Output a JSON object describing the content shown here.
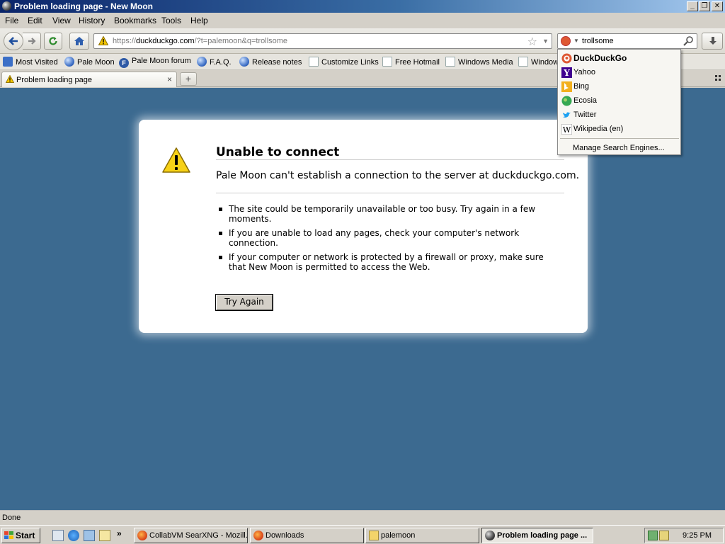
{
  "window": {
    "title": "Problem loading page - New Moon"
  },
  "menu": [
    "File",
    "Edit",
    "View",
    "History",
    "Bookmarks",
    "Tools",
    "Help"
  ],
  "nav": {
    "url_prefix": "https://",
    "url_host": "duckduckgo.com",
    "url_rest": "/?t=palemoon&q=trollsome",
    "search_value": "trollsome"
  },
  "bookmarks": [
    "Most Visited",
    "Pale Moon",
    "Pale Moon forum",
    "F.A.Q.",
    "Release notes",
    "Customize Links",
    "Free Hotmail",
    "Windows Media",
    "Windows"
  ],
  "tab": {
    "title": "Problem loading page",
    "close": "×",
    "new_tab": "+"
  },
  "error": {
    "title": "Unable to connect",
    "description": "Pale Moon can't establish a connection to the server at duckduckgo.com.",
    "items": [
      "The site could be temporarily unavailable or too busy. Try again in a few moments.",
      "If you are unable to load any pages, check your computer's network connection.",
      "If your computer or network is protected by a firewall or proxy, make sure that New Moon is permitted to access the Web."
    ],
    "button": "Try Again"
  },
  "search_engines": {
    "items": [
      "DuckDuckGo",
      "Yahoo",
      "Bing",
      "Ecosia",
      "Twitter",
      "Wikipedia (en)"
    ],
    "selected": "DuckDuckGo",
    "manage": "Manage Search Engines..."
  },
  "status": {
    "text": "Done"
  },
  "taskbar": {
    "start": "Start",
    "buttons": [
      {
        "label": "CollabVM SearXNG - Mozill..."
      },
      {
        "label": "Downloads"
      },
      {
        "label": "palemoon"
      },
      {
        "label": "Problem loading page ..."
      }
    ],
    "active_index": 3,
    "clock": "9:25 PM"
  },
  "colors": {
    "content_bg": "#3c6a90",
    "titlebar_start": "#0a246a",
    "titlebar_end": "#a6caf0",
    "ddg_orange": "#de5833"
  }
}
